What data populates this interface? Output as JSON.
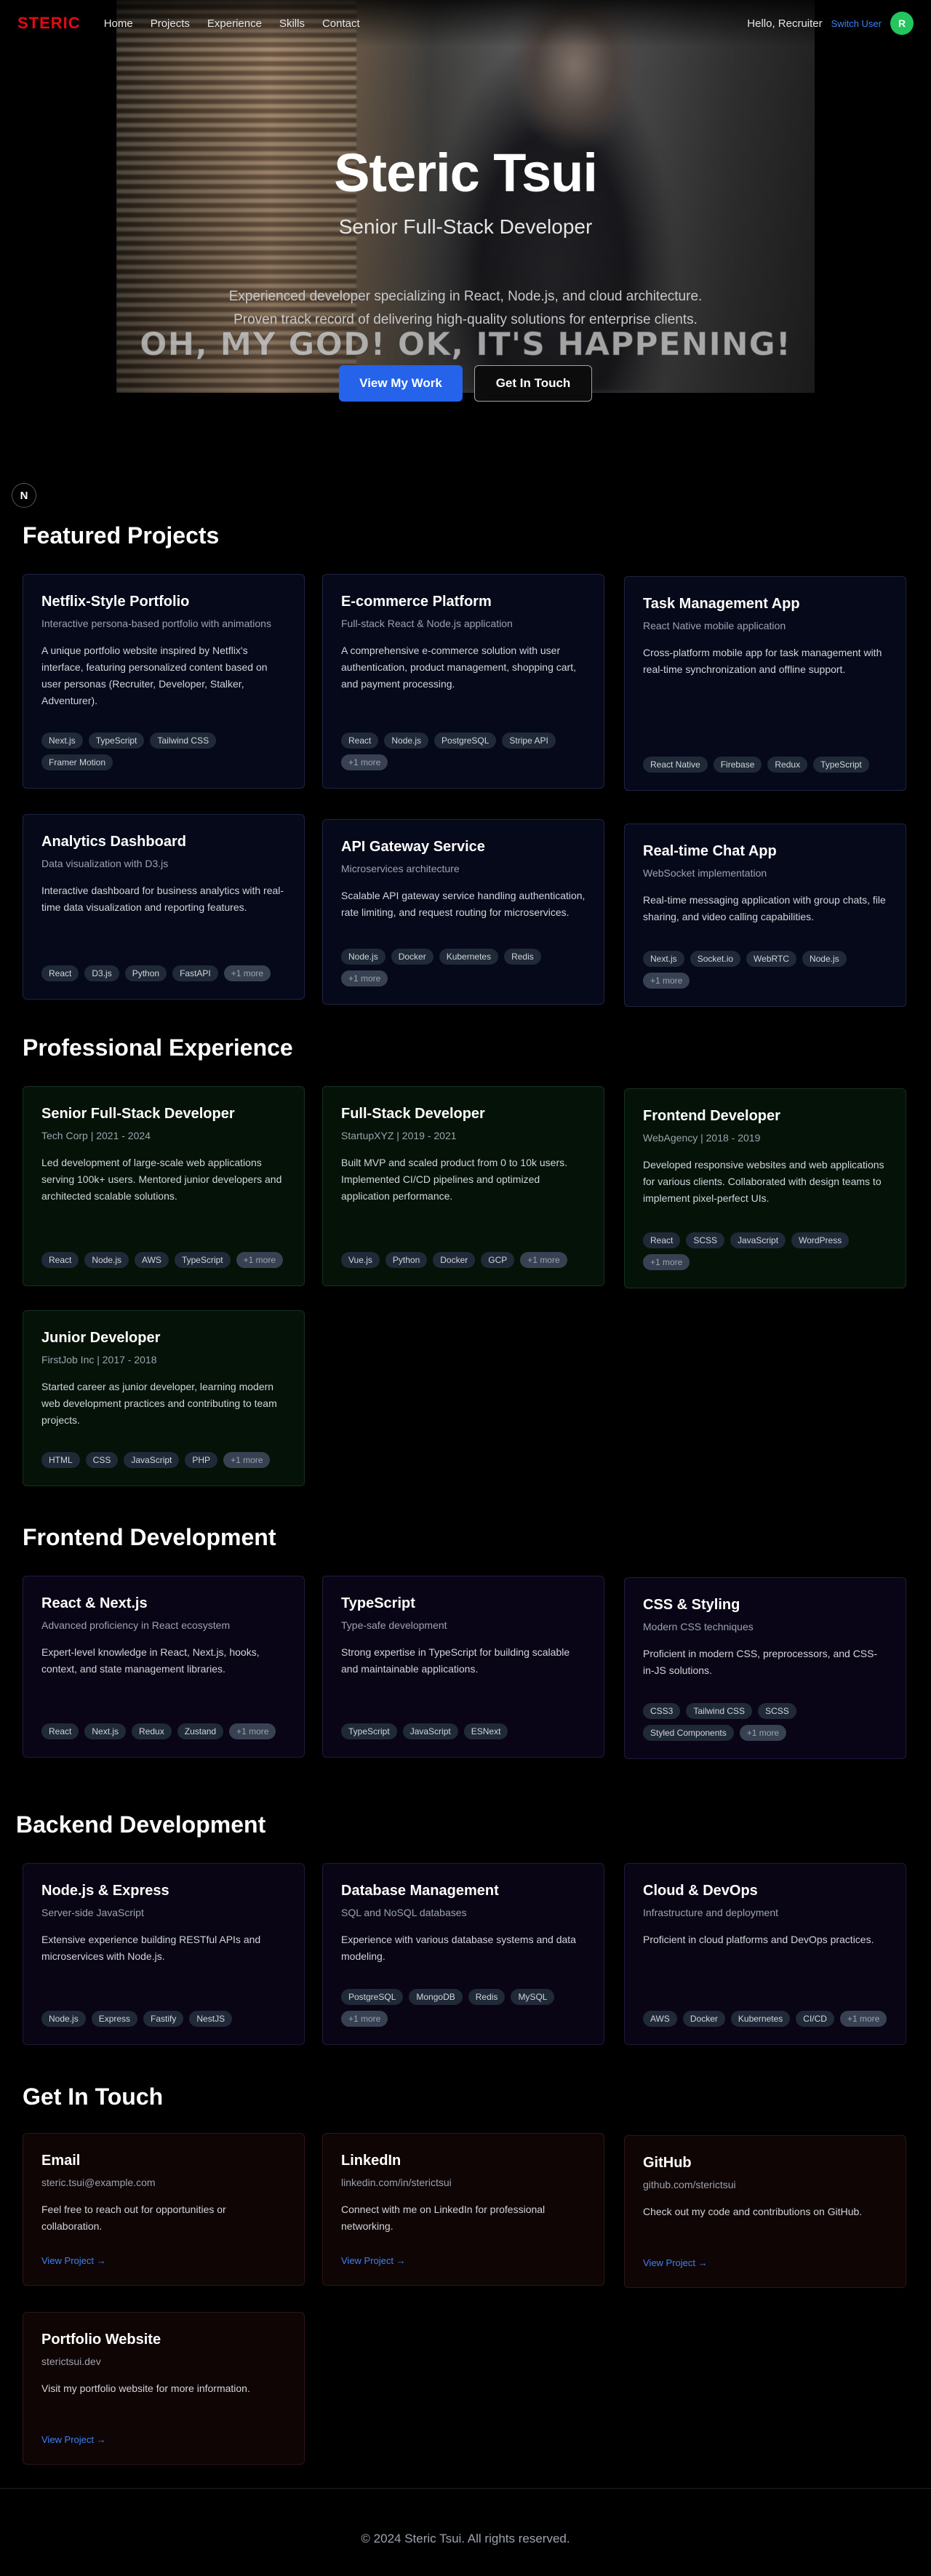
{
  "nav": {
    "logo": "STERIC",
    "links": [
      "Home",
      "Projects",
      "Experience",
      "Skills",
      "Contact"
    ],
    "greeting": "Hello, Recruiter",
    "switch_user": "Switch User",
    "avatar_initial": "R"
  },
  "hero": {
    "name": "Steric Tsui",
    "title": "Senior Full-Stack Developer",
    "description_line1": "Experienced developer specializing in React, Node.js, and cloud architecture.",
    "description_line2": "Proven track record of delivering high-quality solutions for enterprise clients.",
    "meme_caption": "OH, MY GOD! OK, IT'S HAPPENING!",
    "primary_button": "View My Work",
    "secondary_button": "Get In Touch"
  },
  "floating_badge": "N",
  "projects": {
    "title": "Featured Projects",
    "items": [
      {
        "title": "Netflix-Style Portfolio",
        "subtitle": "Interactive persona-based portfolio with animations",
        "description": "A unique portfolio website inspired by Netflix's interface, featuring personalized content based on user personas (Recruiter, Developer, Stalker, Adventurer).",
        "tags": [
          "Next.js",
          "TypeScript",
          "Tailwind CSS",
          "Framer Motion"
        ]
      },
      {
        "title": "E-commerce Platform",
        "subtitle": "Full-stack React & Node.js application",
        "description": "A comprehensive e-commerce solution with user authentication, product management, shopping cart, and payment processing.",
        "tags": [
          "React",
          "Node.js",
          "PostgreSQL",
          "Stripe API",
          "+1 more"
        ]
      },
      {
        "title": "Task Management App",
        "subtitle": "React Native mobile application",
        "description": "Cross-platform mobile app for task management with real-time synchronization and offline support.",
        "tags": [
          "React Native",
          "Firebase",
          "Redux",
          "TypeScript"
        ]
      },
      {
        "title": "Analytics Dashboard",
        "subtitle": "Data visualization with D3.js",
        "description": "Interactive dashboard for business analytics with real-time data visualization and reporting features.",
        "tags": [
          "React",
          "D3.js",
          "Python",
          "FastAPI",
          "+1 more"
        ]
      },
      {
        "title": "API Gateway Service",
        "subtitle": "Microservices architecture",
        "description": "Scalable API gateway service handling authentication, rate limiting, and request routing for microservices.",
        "tags": [
          "Node.js",
          "Docker",
          "Kubernetes",
          "Redis",
          "+1 more"
        ]
      },
      {
        "title": "Real-time Chat App",
        "subtitle": "WebSocket implementation",
        "description": "Real-time messaging application with group chats, file sharing, and video calling capabilities.",
        "tags": [
          "Next.js",
          "Socket.io",
          "WebRTC",
          "Node.js",
          "+1 more"
        ]
      }
    ]
  },
  "experience": {
    "title": "Professional Experience",
    "items": [
      {
        "title": "Senior Full-Stack Developer",
        "subtitle": "Tech Corp | 2021 - 2024",
        "description": "Led development of large-scale web applications serving 100k+ users. Mentored junior developers and architected scalable solutions.",
        "tags": [
          "React",
          "Node.js",
          "AWS",
          "TypeScript",
          "+1 more"
        ]
      },
      {
        "title": "Full-Stack Developer",
        "subtitle": "StartupXYZ | 2019 - 2021",
        "description": "Built MVP and scaled product from 0 to 10k users. Implemented CI/CD pipelines and optimized application performance.",
        "tags": [
          "Vue.js",
          "Python",
          "Docker",
          "GCP",
          "+1 more"
        ]
      },
      {
        "title": "Frontend Developer",
        "subtitle": "WebAgency | 2018 - 2019",
        "description": "Developed responsive websites and web applications for various clients. Collaborated with design teams to implement pixel-perfect UIs.",
        "tags": [
          "React",
          "SCSS",
          "JavaScript",
          "WordPress",
          "+1 more"
        ]
      },
      {
        "title": "Junior Developer",
        "subtitle": "FirstJob Inc | 2017 - 2018",
        "description": "Started career as junior developer, learning modern web development practices and contributing to team projects.",
        "tags": [
          "HTML",
          "CSS",
          "JavaScript",
          "PHP",
          "+1 more"
        ]
      }
    ]
  },
  "frontend": {
    "title": "Frontend Development",
    "items": [
      {
        "title": "React & Next.js",
        "subtitle": "Advanced proficiency in React ecosystem",
        "description": "Expert-level knowledge in React, Next.js, hooks, context, and state management libraries.",
        "tags": [
          "React",
          "Next.js",
          "Redux",
          "Zustand",
          "+1 more"
        ]
      },
      {
        "title": "TypeScript",
        "subtitle": "Type-safe development",
        "description": "Strong expertise in TypeScript for building scalable and maintainable applications.",
        "tags": [
          "TypeScript",
          "JavaScript",
          "ESNext"
        ]
      },
      {
        "title": "CSS & Styling",
        "subtitle": "Modern CSS techniques",
        "description": "Proficient in modern CSS, preprocessors, and CSS-in-JS solutions.",
        "tags": [
          "CSS3",
          "Tailwind CSS",
          "SCSS",
          "Styled Components",
          "+1 more"
        ]
      }
    ]
  },
  "backend": {
    "title": "Backend Development",
    "items": [
      {
        "title": "Node.js & Express",
        "subtitle": "Server-side JavaScript",
        "description": "Extensive experience building RESTful APIs and microservices with Node.js.",
        "tags": [
          "Node.js",
          "Express",
          "Fastify",
          "NestJS"
        ]
      },
      {
        "title": "Database Management",
        "subtitle": "SQL and NoSQL databases",
        "description": "Experience with various database systems and data modeling.",
        "tags": [
          "PostgreSQL",
          "MongoDB",
          "Redis",
          "MySQL",
          "+1 more"
        ]
      },
      {
        "title": "Cloud & DevOps",
        "subtitle": "Infrastructure and deployment",
        "description": "Proficient in cloud platforms and DevOps practices.",
        "tags": [
          "AWS",
          "Docker",
          "Kubernetes",
          "CI/CD",
          "+1 more"
        ]
      }
    ]
  },
  "contact": {
    "title": "Get In Touch",
    "link_label": "View Project →",
    "items": [
      {
        "title": "Email",
        "subtitle": "steric.tsui@example.com",
        "description": "Feel free to reach out for opportunities or collaboration."
      },
      {
        "title": "LinkedIn",
        "subtitle": "linkedin.com/in/sterictsui",
        "description": "Connect with me on LinkedIn for professional networking."
      },
      {
        "title": "GitHub",
        "subtitle": "github.com/sterictsui",
        "description": "Check out my code and contributions on GitHub."
      },
      {
        "title": "Portfolio Website",
        "subtitle": "sterictsui.dev",
        "description": "Visit my portfolio website for more information."
      }
    ]
  },
  "footer": {
    "copyright": "© 2024 Steric Tsui. All rights reserved."
  },
  "colors": {
    "brand": "#e50914",
    "accent": "#2563eb",
    "link": "#3b82f6",
    "avatar": "#22c55e"
  }
}
